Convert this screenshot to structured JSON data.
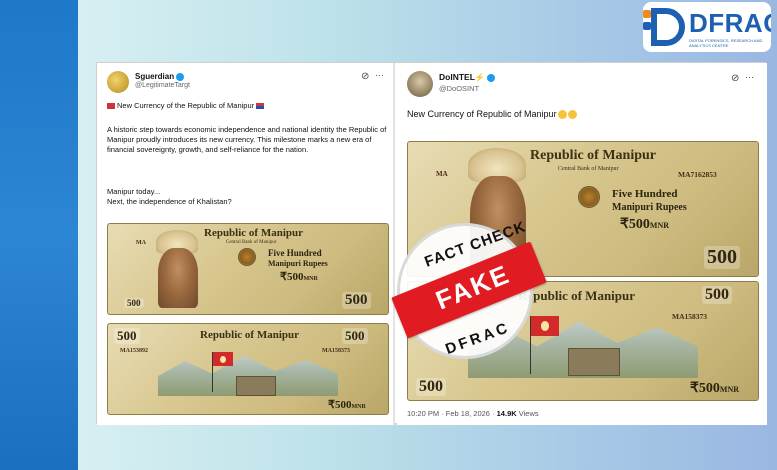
{
  "logo": {
    "brand": "DFRAC",
    "tagline": "DIGITAL FORENSICS, RESEARCH AND ANALYTICS CENTRE"
  },
  "left_post": {
    "display_name": "Sguerdian",
    "handle": "@LegitimateTargt",
    "text_line1": "New Currency of the Republic of Manipur",
    "paragraph": "A historic step towards economic independence and national identity the Republic of Manipur proudly introduces its new currency. This milestone marks a new era of financial sovereignty, growth, and self-reliance for the nation.",
    "line_manipur": "Manipur today...",
    "line_next": "Next, the independence of Khalistan?",
    "more_label": "···"
  },
  "right_post": {
    "display_name": "DoINTEL",
    "handle": "@DoOSINT",
    "text": "New Currency of Republic of Manipur",
    "more_label": "···",
    "timestamp_prefix": "10:20 PM · Feb 18, 2026 · ",
    "views_count": "14.9K",
    "views_label": " Views"
  },
  "note_front": {
    "title": "Republic of Manipur",
    "bank": "Central Bank of Manipur",
    "denom_line1": "Five Hundred",
    "denom_line2": "Manipuri Rupees",
    "amount": "₹500",
    "unit": "MNR",
    "serial_prefix": "MA",
    "serial": "MA7162853",
    "corner_value": "500"
  },
  "note_back": {
    "title": "Republic of Manipur",
    "serial_left": "MA153892",
    "serial_right": "MA158373",
    "corner_value": "500",
    "bottom_amount": "₹500",
    "bottom_unit": "MNR"
  },
  "stamp": {
    "top_text": "FACT CHECK",
    "banner": "FAKE",
    "bottom_text": "DFRAC"
  },
  "colors": {
    "accent_blue": "#1d5fb0",
    "accent_orange": "#f08a1c",
    "fake_red": "#e11b22"
  }
}
